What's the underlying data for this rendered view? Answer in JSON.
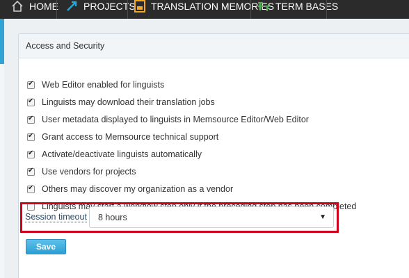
{
  "nav": {
    "items": [
      {
        "label": "Home",
        "icon": "home-icon"
      },
      {
        "label": "Projects",
        "icon": "projects-icon"
      },
      {
        "label": "Translation Memories",
        "icon": "translation-memories-icon"
      },
      {
        "label": "Term Bases",
        "icon": "term-bases-icon"
      }
    ]
  },
  "panel": {
    "title": "Access and Security",
    "options": [
      {
        "label": "Web Editor enabled for linguists",
        "checked": true
      },
      {
        "label": "Linguists may download their translation jobs",
        "checked": true
      },
      {
        "label": "User metadata displayed to linguists in Memsource Editor/Web Editor",
        "checked": true
      },
      {
        "label": "Grant access to Memsource technical support",
        "checked": true
      },
      {
        "label": "Activate/deactivate linguists automatically",
        "checked": true
      },
      {
        "label": "Use vendors for projects",
        "checked": true
      },
      {
        "label": "Others may discover my organization as a vendor",
        "checked": true
      },
      {
        "label": "Linguists may start a workflow step only if the preceding step has been completed",
        "checked": false
      }
    ],
    "session_timeout": {
      "label": "Session timeout",
      "value": "8 hours"
    },
    "save_label": "Save"
  },
  "colors": {
    "nav_bg": "#2b2b2b",
    "accent_blue": "#2fa3d4",
    "highlight_red": "#d0021b",
    "save_button": "#3aa8da"
  }
}
